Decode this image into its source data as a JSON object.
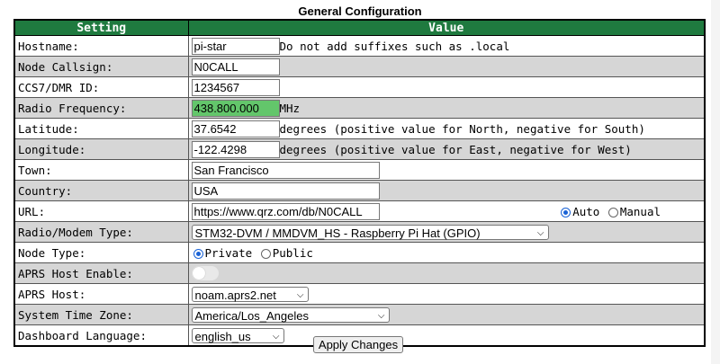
{
  "title": "General Configuration",
  "headers": {
    "setting": "Setting",
    "value": "Value"
  },
  "rows": {
    "hostname": {
      "label": "Hostname:",
      "value": "pi-star",
      "note": "Do not add suffixes such as .local"
    },
    "callsign": {
      "label": "Node Callsign:",
      "value": "N0CALL"
    },
    "dmrid": {
      "label": "CCS7/DMR ID:",
      "value": "1234567"
    },
    "freq": {
      "label": "Radio Frequency:",
      "value": "438.800.000",
      "unit": "MHz"
    },
    "lat": {
      "label": "Latitude:",
      "value": "37.6542",
      "note": "degrees (positive value for North, negative for South)"
    },
    "lon": {
      "label": "Longitude:",
      "value": "-122.4298",
      "note": "degrees (positive value for East, negative for West)"
    },
    "town": {
      "label": "Town:",
      "value": "San Francisco"
    },
    "country": {
      "label": "Country:",
      "value": "USA"
    },
    "url": {
      "label": "URL:",
      "value": "https://www.qrz.com/db/N0CALL",
      "auto": "Auto",
      "manual": "Manual",
      "selected": "Auto"
    },
    "modem": {
      "label": "Radio/Modem Type:",
      "value": "STM32-DVM / MMDVM_HS - Raspberry Pi Hat (GPIO)"
    },
    "nodetype": {
      "label": "Node Type:",
      "private": "Private",
      "public": "Public",
      "selected": "Private"
    },
    "aprs_enable": {
      "label": "APRS Host Enable:",
      "enabled": false
    },
    "aprs_host": {
      "label": "APRS Host:",
      "value": "noam.aprs2.net"
    },
    "timezone": {
      "label": "System Time Zone:",
      "value": "America/Los_Angeles"
    },
    "language": {
      "label": "Dashboard Language:",
      "value": "english_us"
    }
  },
  "apply_label": "Apply Changes",
  "colors": {
    "header_bg": "#1f7a3f",
    "freq_bg": "#63c66b",
    "row_alt": "#d6d6d6"
  }
}
